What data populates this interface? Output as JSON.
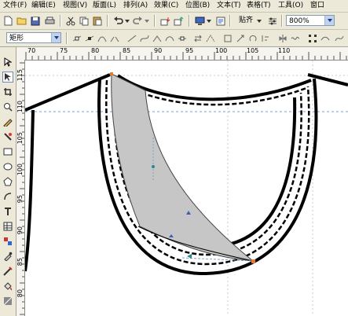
{
  "menu": [
    {
      "label": "文件(F)"
    },
    {
      "label": "编辑(E)"
    },
    {
      "label": "视图(V)"
    },
    {
      "label": "版面(L)"
    },
    {
      "label": "排列(A)"
    },
    {
      "label": "效果(C)"
    },
    {
      "label": "位图(B)"
    },
    {
      "label": "文本(T)"
    },
    {
      "label": "表格(T)"
    },
    {
      "label": "工具(O)"
    },
    {
      "label": "窗口"
    }
  ],
  "toolbar": {
    "snap_label": "贴齐",
    "zoom_value": "800%"
  },
  "property_bar": {
    "shape_label": "矩形"
  },
  "ruler": {
    "top_labels": [
      "70",
      "75",
      "80",
      "85",
      "90",
      "95",
      "100",
      "105",
      "110"
    ],
    "left_labels": [
      "115",
      "110",
      "105",
      "100",
      "95",
      "90",
      "85",
      "80"
    ]
  },
  "colors": {
    "ui_bg": "#ece9d8",
    "panel_fill": "#c6c6c6",
    "node_orange": "#e87a30",
    "guide_blue": "#7fa0c8"
  },
  "icons": [
    "new-icon",
    "open-icon",
    "save-icon",
    "print-icon",
    "cut-icon",
    "copy-icon",
    "paste-icon",
    "undo-icon",
    "redo-icon",
    "import-icon",
    "export-icon",
    "application-launcher-icon",
    "welcome-icon",
    "snap-icon",
    "options-icon",
    "pick-tool-icon",
    "shape-tool-icon",
    "crop-tool-icon",
    "zoom-tool-icon",
    "freehand-tool-icon",
    "smart-fill-icon",
    "rectangle-tool-icon",
    "ellipse-tool-icon",
    "polygon-tool-icon",
    "basic-shapes-icon",
    "text-tool-icon",
    "table-tool-icon",
    "interactive-blend-icon",
    "eyedropper-icon",
    "outline-tool-icon",
    "fill-tool-icon",
    "interactive-fill-icon"
  ]
}
